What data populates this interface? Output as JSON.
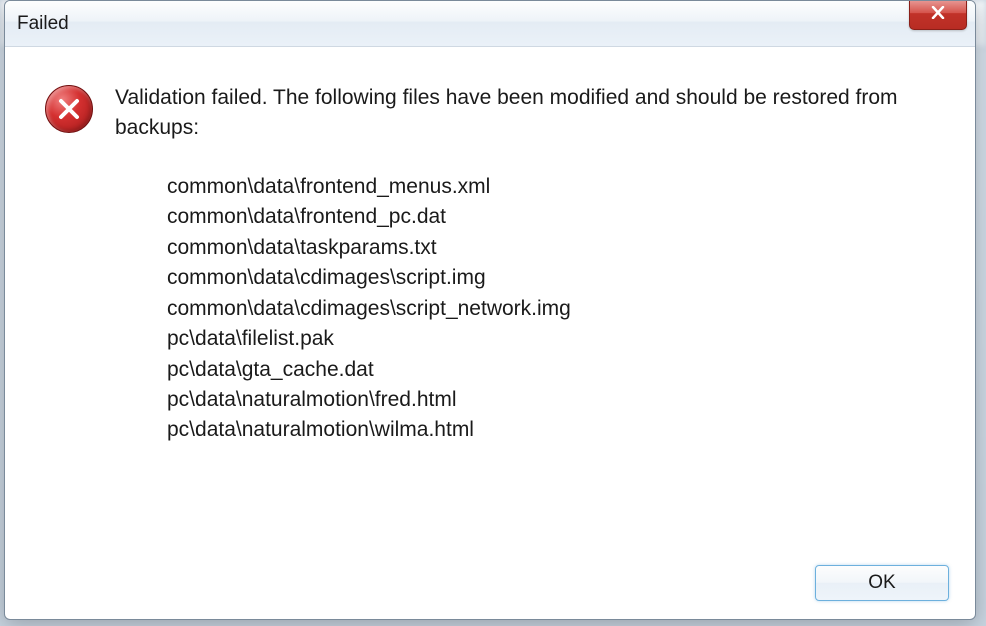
{
  "title": "Failed",
  "close_label": "X",
  "error_icon": "error-x-icon",
  "main_message": "Validation failed. The following files have been modified and should be restored from backups:",
  "files": [
    "common\\data\\frontend_menus.xml",
    "common\\data\\frontend_pc.dat",
    "common\\data\\taskparams.txt",
    "common\\data\\cdimages\\script.img",
    "common\\data\\cdimages\\script_network.img",
    "pc\\data\\filelist.pak",
    "pc\\data\\gta_cache.dat",
    "pc\\data\\naturalmotion\\fred.html",
    "pc\\data\\naturalmotion\\wilma.html"
  ],
  "ok_label": "OK"
}
